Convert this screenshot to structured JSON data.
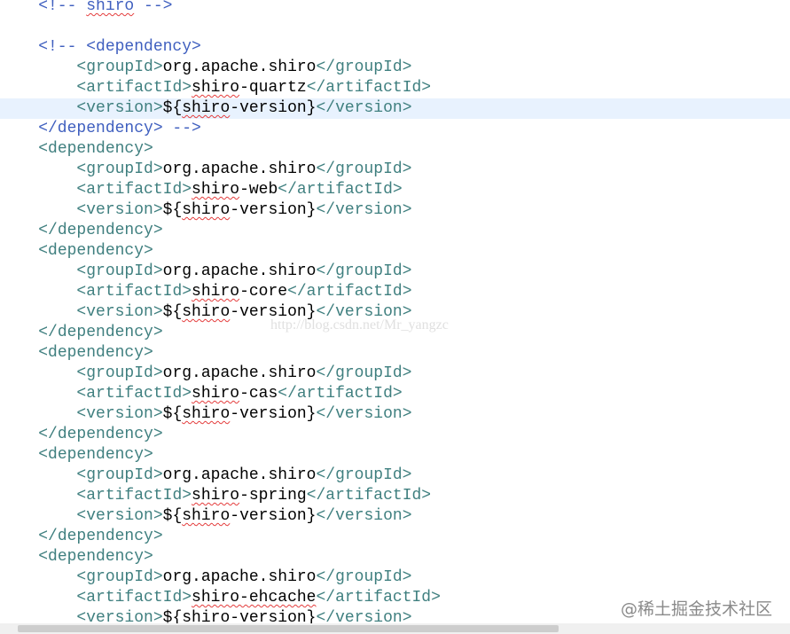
{
  "editor": {
    "current_line": 5,
    "lines": [
      [
        {
          "t": "    <!-- ",
          "c": "cmt"
        },
        {
          "t": "shiro",
          "c": "cmt",
          "sq": true
        },
        {
          "t": " -->",
          "c": "cmt"
        }
      ],
      [],
      [
        {
          "t": "    <!-- <dependency>",
          "c": "cmt"
        }
      ],
      [
        {
          "t": "        ",
          "c": "txt"
        },
        {
          "t": "<groupId>",
          "c": "tag"
        },
        {
          "t": "org.apache.shiro",
          "c": "txt"
        },
        {
          "t": "</groupId>",
          "c": "tag"
        }
      ],
      [
        {
          "t": "        ",
          "c": "txt"
        },
        {
          "t": "<artifactId>",
          "c": "tag"
        },
        {
          "t": "shiro",
          "c": "txt",
          "sq": true
        },
        {
          "t": "-quartz",
          "c": "txt"
        },
        {
          "t": "</artifactId>",
          "c": "tag"
        }
      ],
      [
        {
          "t": "        ",
          "c": "txt"
        },
        {
          "t": "<version>",
          "c": "tag"
        },
        {
          "t": "${",
          "c": "txt"
        },
        {
          "t": "shiro",
          "c": "txt",
          "sq": true
        },
        {
          "t": "-version}",
          "c": "txt"
        },
        {
          "t": "</version>",
          "c": "tag"
        }
      ],
      [
        {
          "t": "    </dependency> -->",
          "c": "cmt"
        }
      ],
      [
        {
          "t": "    ",
          "c": "txt"
        },
        {
          "t": "<dependency>",
          "c": "tag"
        }
      ],
      [
        {
          "t": "        ",
          "c": "txt"
        },
        {
          "t": "<groupId>",
          "c": "tag"
        },
        {
          "t": "org.apache.shiro",
          "c": "txt"
        },
        {
          "t": "</groupId>",
          "c": "tag"
        }
      ],
      [
        {
          "t": "        ",
          "c": "txt"
        },
        {
          "t": "<artifactId>",
          "c": "tag"
        },
        {
          "t": "shiro",
          "c": "txt",
          "sq": true
        },
        {
          "t": "-web",
          "c": "txt"
        },
        {
          "t": "</artifactId>",
          "c": "tag"
        }
      ],
      [
        {
          "t": "        ",
          "c": "txt"
        },
        {
          "t": "<version>",
          "c": "tag"
        },
        {
          "t": "${",
          "c": "txt"
        },
        {
          "t": "shiro",
          "c": "txt",
          "sq": true
        },
        {
          "t": "-version}",
          "c": "txt"
        },
        {
          "t": "</version>",
          "c": "tag"
        }
      ],
      [
        {
          "t": "    ",
          "c": "txt"
        },
        {
          "t": "</dependency>",
          "c": "tag"
        }
      ],
      [
        {
          "t": "    ",
          "c": "txt"
        },
        {
          "t": "<dependency>",
          "c": "tag"
        }
      ],
      [
        {
          "t": "        ",
          "c": "txt"
        },
        {
          "t": "<groupId>",
          "c": "tag"
        },
        {
          "t": "org.apache.shiro",
          "c": "txt"
        },
        {
          "t": "</groupId>",
          "c": "tag"
        }
      ],
      [
        {
          "t": "        ",
          "c": "txt"
        },
        {
          "t": "<artifactId>",
          "c": "tag"
        },
        {
          "t": "shiro",
          "c": "txt",
          "sq": true
        },
        {
          "t": "-core",
          "c": "txt"
        },
        {
          "t": "</artifactId>",
          "c": "tag"
        }
      ],
      [
        {
          "t": "        ",
          "c": "txt"
        },
        {
          "t": "<version>",
          "c": "tag"
        },
        {
          "t": "${",
          "c": "txt"
        },
        {
          "t": "shiro",
          "c": "txt",
          "sq": true
        },
        {
          "t": "-version}",
          "c": "txt"
        },
        {
          "t": "</version>",
          "c": "tag"
        }
      ],
      [
        {
          "t": "    ",
          "c": "txt"
        },
        {
          "t": "</dependency>",
          "c": "tag"
        }
      ],
      [
        {
          "t": "    ",
          "c": "txt"
        },
        {
          "t": "<dependency>",
          "c": "tag"
        }
      ],
      [
        {
          "t": "        ",
          "c": "txt"
        },
        {
          "t": "<groupId>",
          "c": "tag"
        },
        {
          "t": "org.apache.shiro",
          "c": "txt"
        },
        {
          "t": "</groupId>",
          "c": "tag"
        }
      ],
      [
        {
          "t": "        ",
          "c": "txt"
        },
        {
          "t": "<artifactId>",
          "c": "tag"
        },
        {
          "t": "shiro",
          "c": "txt",
          "sq": true
        },
        {
          "t": "-cas",
          "c": "txt"
        },
        {
          "t": "</artifactId>",
          "c": "tag"
        }
      ],
      [
        {
          "t": "        ",
          "c": "txt"
        },
        {
          "t": "<version>",
          "c": "tag"
        },
        {
          "t": "${",
          "c": "txt"
        },
        {
          "t": "shiro",
          "c": "txt",
          "sq": true
        },
        {
          "t": "-version}",
          "c": "txt"
        },
        {
          "t": "</version>",
          "c": "tag"
        }
      ],
      [
        {
          "t": "    ",
          "c": "txt"
        },
        {
          "t": "</dependency>",
          "c": "tag"
        }
      ],
      [
        {
          "t": "    ",
          "c": "txt"
        },
        {
          "t": "<dependency>",
          "c": "tag"
        }
      ],
      [
        {
          "t": "        ",
          "c": "txt"
        },
        {
          "t": "<groupId>",
          "c": "tag"
        },
        {
          "t": "org.apache.shiro",
          "c": "txt"
        },
        {
          "t": "</groupId>",
          "c": "tag"
        }
      ],
      [
        {
          "t": "        ",
          "c": "txt"
        },
        {
          "t": "<artifactId>",
          "c": "tag"
        },
        {
          "t": "shiro",
          "c": "txt",
          "sq": true
        },
        {
          "t": "-spring",
          "c": "txt"
        },
        {
          "t": "</artifactId>",
          "c": "tag"
        }
      ],
      [
        {
          "t": "        ",
          "c": "txt"
        },
        {
          "t": "<version>",
          "c": "tag"
        },
        {
          "t": "${",
          "c": "txt"
        },
        {
          "t": "shiro",
          "c": "txt",
          "sq": true
        },
        {
          "t": "-version}",
          "c": "txt"
        },
        {
          "t": "</version>",
          "c": "tag"
        }
      ],
      [
        {
          "t": "    ",
          "c": "txt"
        },
        {
          "t": "</dependency>",
          "c": "tag"
        }
      ],
      [
        {
          "t": "    ",
          "c": "txt"
        },
        {
          "t": "<dependency>",
          "c": "tag"
        }
      ],
      [
        {
          "t": "        ",
          "c": "txt"
        },
        {
          "t": "<groupId>",
          "c": "tag"
        },
        {
          "t": "org.apache.shiro",
          "c": "txt"
        },
        {
          "t": "</groupId>",
          "c": "tag"
        }
      ],
      [
        {
          "t": "        ",
          "c": "txt"
        },
        {
          "t": "<artifactId>",
          "c": "tag"
        },
        {
          "t": "shiro-ehcache",
          "c": "txt",
          "sq": true
        },
        {
          "t": "</artifactId>",
          "c": "tag"
        }
      ],
      [
        {
          "t": "        ",
          "c": "txt"
        },
        {
          "t": "<version>",
          "c": "tag"
        },
        {
          "t": "${",
          "c": "txt"
        },
        {
          "t": "shiro",
          "c": "txt",
          "sq": true
        },
        {
          "t": "-version}",
          "c": "txt"
        },
        {
          "t": "</version>",
          "c": "tag"
        }
      ]
    ]
  },
  "watermark": "http://blog.csdn.net/Mr_yangzc",
  "footer_brand": "@稀土掘金技术社区",
  "colors": {
    "tag": "#3f7f7f",
    "comment": "#3f5fbf",
    "text": "#000000",
    "current_line_bg": "#e8f2fe",
    "spellcheck": "#e43d3d"
  }
}
